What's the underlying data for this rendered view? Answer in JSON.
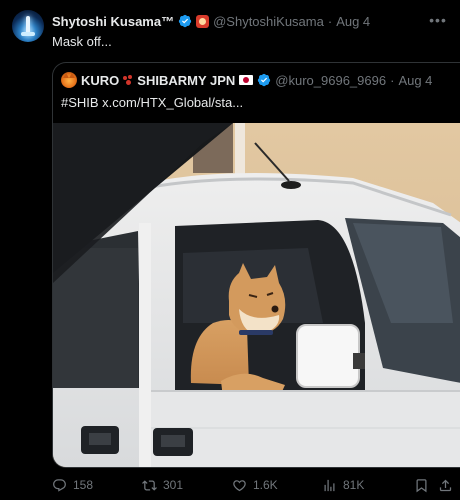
{
  "author": {
    "display_name": "Shytoshi Kusama™",
    "handle": "@ShytoshiKusama",
    "separator": "·",
    "date": "Aug 4",
    "verified": true,
    "avatar_icon": "spire-avatar",
    "badge_icon": "shib-badge-icon"
  },
  "tweet": {
    "text": "Mask off..."
  },
  "quoted_tweet": {
    "display_name": "KURO",
    "display_name_suffix": "SHIBARMY JPN",
    "handle": "@kuro_9696_9696",
    "separator": "·",
    "date": "Aug 4",
    "text": "#SHIB  x.com/HTX_Global/sta...",
    "verified": true,
    "media_description_icon": "shiba-in-truck-photo"
  },
  "actions": {
    "replies": "158",
    "reposts": "301",
    "likes": "1.6K",
    "views": "81K"
  },
  "colors": {
    "background": "#000000",
    "text": "#e7e9ea",
    "muted": "#71767b",
    "verified_blue": "#1d9bf0",
    "border": "#2f3336"
  }
}
